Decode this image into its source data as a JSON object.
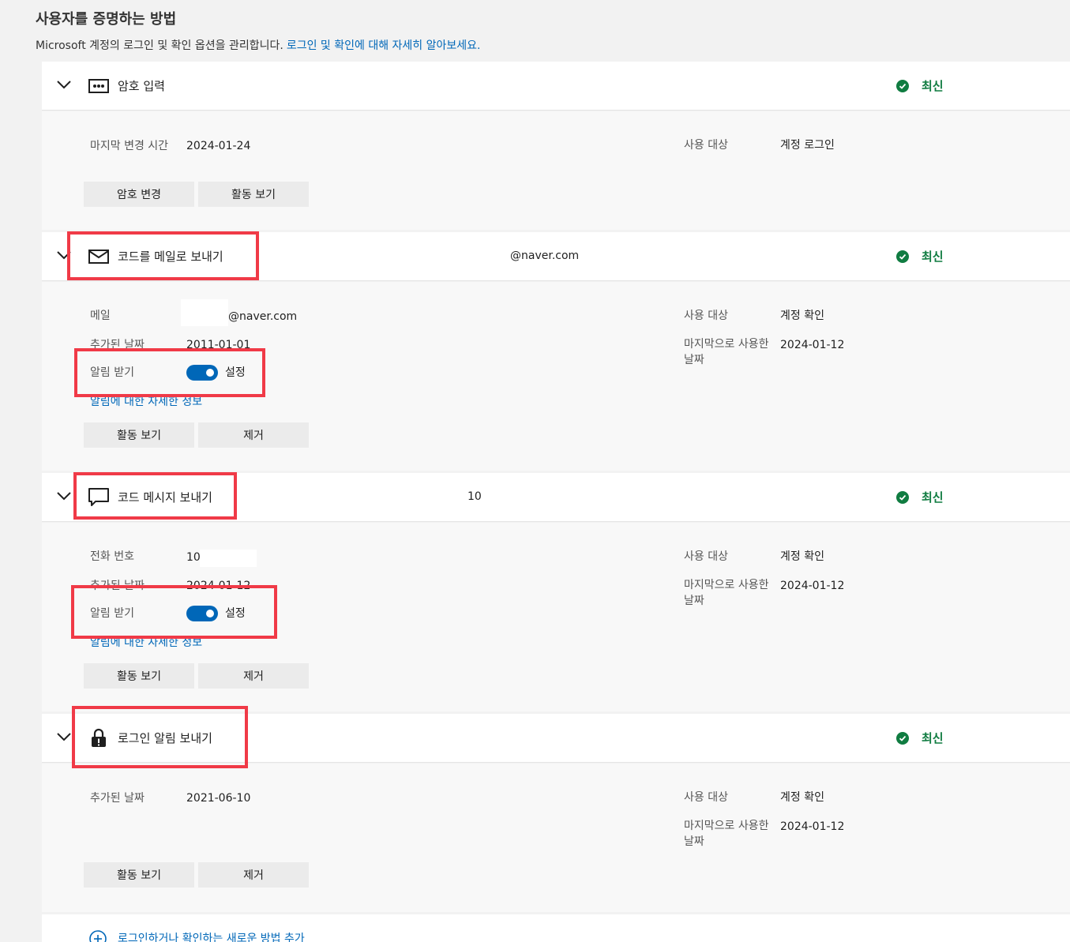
{
  "page": {
    "title": "사용자를 증명하는 방법",
    "subtitle": "Microsoft 계정의 로그인 및 확인 옵션을 관리합니다.",
    "learn_more": "로그인 및 확인에 대해 자세히 알아보세요."
  },
  "colors": {
    "accent": "#0067b8",
    "status_green": "#107c41",
    "highlight": "#f03a47"
  },
  "methods": [
    {
      "title": "암호 입력",
      "icon": "password-dots-icon",
      "contact": "",
      "status": "최신",
      "details_left": [
        {
          "label": "마지막 변경 시간",
          "value": "2024-01-24"
        }
      ],
      "details_right": [
        {
          "label": "사용 대상",
          "value": "계정 로그인"
        }
      ],
      "buttons": [
        "암호 변경",
        "활동 보기"
      ]
    },
    {
      "title": "코드를 메일로 보내기",
      "icon": "mail-icon",
      "contact": "@naver.com",
      "status": "최신",
      "details_left": [
        {
          "label": "메일",
          "value": "@naver.com"
        },
        {
          "label": "추가된 날짜",
          "value": "2011-01-01"
        }
      ],
      "notify": {
        "label": "알림 받기",
        "state": "설정"
      },
      "notify_link": "알림에 대한 자세한 정보",
      "details_right": [
        {
          "label": "사용 대상",
          "value": "계정 확인"
        },
        {
          "label": "마지막으로 사용한 날짜",
          "value": "2024-01-12"
        }
      ],
      "buttons": [
        "활동 보기",
        "제거"
      ]
    },
    {
      "title": "코드 메시지 보내기",
      "icon": "chat-bubble-icon",
      "contact": "10",
      "status": "최신",
      "details_left": [
        {
          "label": "전화 번호",
          "value": "10"
        },
        {
          "label": "추가된 날짜",
          "value": "2024-01-12"
        }
      ],
      "notify": {
        "label": "알림 받기",
        "state": "설정"
      },
      "notify_link": "알림에 대한 자세한 정보",
      "details_right": [
        {
          "label": "사용 대상",
          "value": "계정 확인"
        },
        {
          "label": "마지막으로 사용한 날짜",
          "value": "2024-01-12"
        }
      ],
      "buttons": [
        "활동 보기",
        "제거"
      ]
    },
    {
      "title": "로그인 알림 보내기",
      "icon": "lock-alert-icon",
      "contact": "",
      "status": "최신",
      "details_left": [
        {
          "label": "추가된 날짜",
          "value": "2021-06-10"
        }
      ],
      "details_right": [
        {
          "label": "사용 대상",
          "value": "계정 확인"
        },
        {
          "label": "마지막으로 사용한 날짜",
          "value": "2024-01-12"
        }
      ],
      "buttons": [
        "활동 보기",
        "제거"
      ]
    }
  ],
  "add_method": {
    "label": "로그인하거나 확인하는 새로운 방법 추가",
    "icon": "plus-circle-icon"
  }
}
